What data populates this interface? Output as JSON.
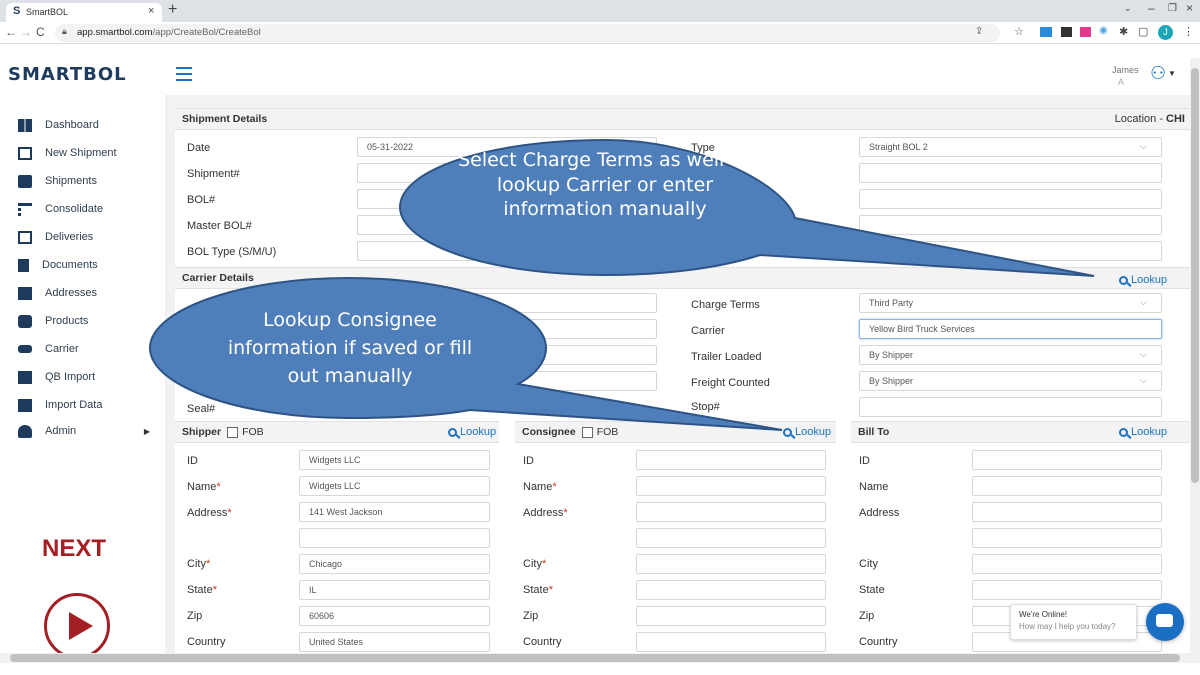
{
  "browser": {
    "tab_title": "SmartBOL",
    "url_domain": "app.smartbol.com",
    "url_path": "/app/CreateBol/CreateBol",
    "profile_initial": "J"
  },
  "app": {
    "logo": "SMARTBOL",
    "user_name": "James",
    "user_initial": "A"
  },
  "sidebar": {
    "items": [
      {
        "label": "Dashboard",
        "icon": "dashboard-icon"
      },
      {
        "label": "New Shipment",
        "icon": "edit-icon"
      },
      {
        "label": "Shipments",
        "icon": "truck-icon"
      },
      {
        "label": "Consolidate",
        "icon": "sitemap-icon"
      },
      {
        "label": "Deliveries",
        "icon": "calendar-icon"
      },
      {
        "label": "Documents",
        "icon": "document-icon"
      },
      {
        "label": "Addresses",
        "icon": "address-book-icon"
      },
      {
        "label": "Products",
        "icon": "box-icon"
      },
      {
        "label": "Carrier",
        "icon": "truck-icon"
      },
      {
        "label": "QB Import",
        "icon": "import-icon"
      },
      {
        "label": "Import Data",
        "icon": "import-icon"
      },
      {
        "label": "Admin",
        "icon": "users-icon"
      }
    ],
    "next_label": "NEXT"
  },
  "shipment": {
    "header": "Shipment Details",
    "location_label": "Location - ",
    "location_value": "CHI",
    "date_label": "Date",
    "date_value": "05-31-2022",
    "shipment_no_label": "Shipment#",
    "bol_label": "BOL#",
    "master_bol_label": "Master BOL#",
    "bol_type_label": "BOL Type (S/M/U)",
    "type_label": "Type",
    "type_value": "Straight BOL 2"
  },
  "carrier": {
    "header": "Carrier Details",
    "lookup": "Lookup",
    "charge_terms_label": "Charge Terms",
    "charge_terms_value": "Third Party",
    "carrier_label": "Carrier",
    "carrier_value": "Yellow Bird Truck Services",
    "trailer_loaded_label": "Trailer Loaded",
    "trailer_loaded_value": "By Shipper",
    "freight_counted_label": "Freight Counted",
    "freight_counted_value": "By Shipper",
    "seal_label": "Seal#",
    "stop_label": "Stop#"
  },
  "parties": {
    "lookup": "Lookup",
    "fob": "FOB",
    "shipper": {
      "title": "Shipper",
      "id_label": "ID",
      "id_value": "Widgets LLC",
      "name_label": "Name",
      "name_value": "Widgets LLC",
      "address_label": "Address",
      "address_value": "141 West Jackson",
      "city_label": "City",
      "city_value": "Chicago",
      "state_label": "State",
      "state_value": "IL",
      "zip_label": "Zip",
      "zip_value": "60606",
      "country_label": "Country",
      "country_value": "United States"
    },
    "consignee": {
      "title": "Consignee",
      "id_label": "ID",
      "name_label": "Name",
      "address_label": "Address",
      "city_label": "City",
      "state_label": "State",
      "zip_label": "Zip",
      "country_label": "Country"
    },
    "billto": {
      "title": "Bill To",
      "id_label": "ID",
      "name_label": "Name",
      "address_label": "Address",
      "city_label": "City",
      "state_label": "State",
      "zip_label": "Zip",
      "country_label": "Country"
    }
  },
  "callouts": {
    "charge_terms": "Select Charge Terms as well as lookup Carrier or enter information manually",
    "consignee": "Lookup Consignee information if saved or fill out manually"
  },
  "chat": {
    "line1": "We're Online!",
    "line2": "How may I help you today?"
  },
  "colors": {
    "callout": "#4f7fba",
    "callout_border": "#2e5486",
    "next": "#a31f24",
    "lookup": "#1b73c3",
    "chat": "#1a6fc2"
  }
}
